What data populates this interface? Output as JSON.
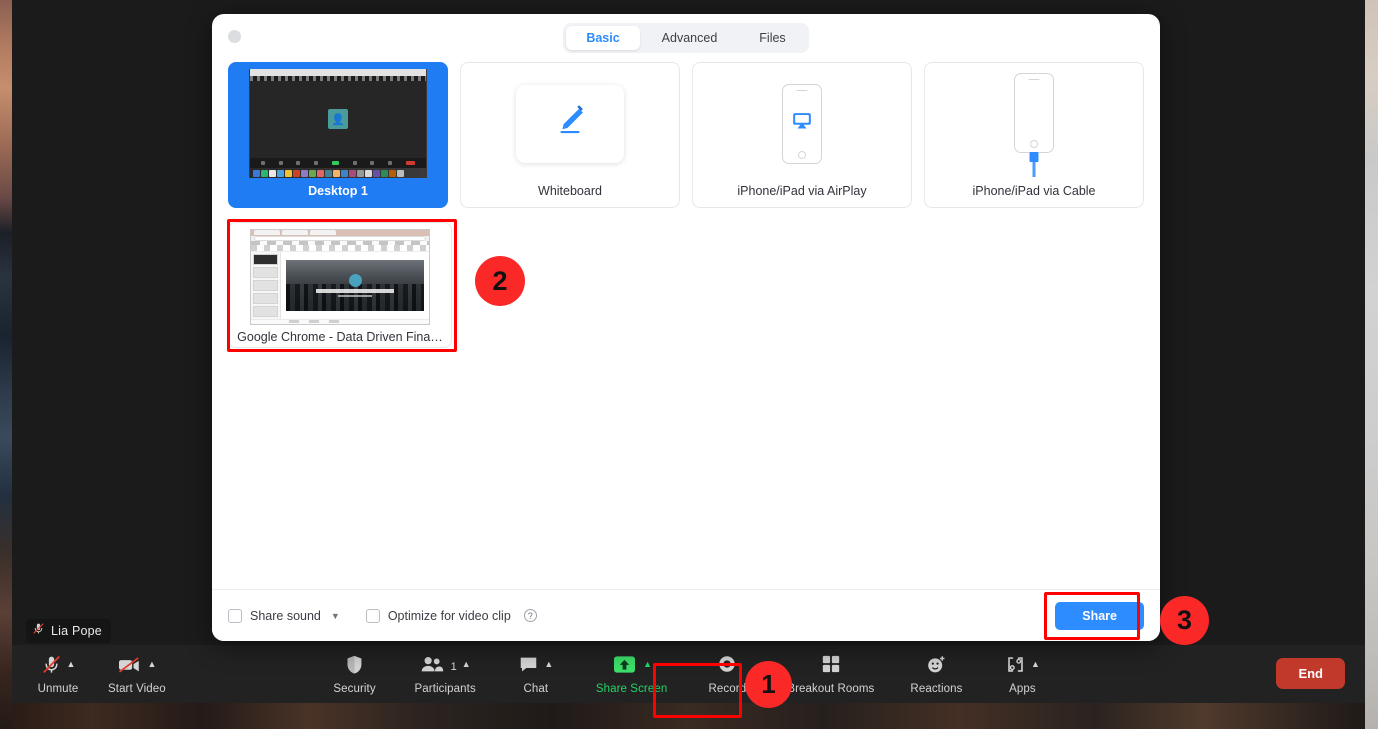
{
  "meeting": {
    "participant_name": "Lia Pope",
    "name_badge_icon": "mic-muted-icon"
  },
  "dialog": {
    "close_button_icon": "close-dot-icon",
    "tabs": [
      {
        "label": "Basic",
        "active": true
      },
      {
        "label": "Advanced",
        "active": false
      },
      {
        "label": "Files",
        "active": false
      }
    ],
    "sources": [
      {
        "label": "Desktop 1",
        "icon": "desktop-thumbnail",
        "selected": true
      },
      {
        "label": "Whiteboard",
        "icon": "pencil-icon",
        "selected": false
      },
      {
        "label": "iPhone/iPad via AirPlay",
        "icon": "airplay-icon",
        "selected": false
      },
      {
        "label": "iPhone/iPad via Cable",
        "icon": "cable-icon",
        "selected": false
      }
    ],
    "windows": [
      {
        "label": "Google Chrome - Data Driven Fina…",
        "icon": "chrome-window-thumbnail",
        "selected": false
      }
    ],
    "footer": {
      "share_sound_label": "Share sound",
      "share_sound_caret_icon": "chevron-down-icon",
      "optimize_label": "Optimize for video clip",
      "optimize_help_icon": "help-circle-icon",
      "help_glyph": "?",
      "share_button_label": "Share"
    }
  },
  "toolbar": {
    "items": [
      {
        "label": "Unmute",
        "icon": "mic-muted-icon",
        "has_caret": true,
        "active": false
      },
      {
        "label": "Start Video",
        "icon": "video-off-icon",
        "has_caret": true,
        "active": false
      },
      {
        "label": "Security",
        "icon": "shield-icon",
        "has_caret": false,
        "active": false
      },
      {
        "label": "Participants",
        "icon": "participants-icon",
        "has_caret": true,
        "count": "1",
        "active": false
      },
      {
        "label": "Chat",
        "icon": "chat-bubble-icon",
        "has_caret": true,
        "active": false
      },
      {
        "label": "Share Screen",
        "icon": "share-screen-up-arrow-icon",
        "has_caret": true,
        "active": true
      },
      {
        "label": "Record",
        "icon": "record-icon",
        "has_caret": false,
        "active": false
      },
      {
        "label": "Breakout Rooms",
        "icon": "grid-squares-icon",
        "has_caret": false,
        "active": false
      },
      {
        "label": "Reactions",
        "icon": "smiley-plus-icon",
        "has_caret": false,
        "active": false
      },
      {
        "label": "Apps",
        "icon": "apps-bracket-icon",
        "has_caret": true,
        "active": false
      }
    ],
    "end_button_label": "End"
  },
  "annotations": {
    "accent_color": "#ff0000",
    "badge_color": "#fb2828",
    "steps": [
      {
        "number": "1",
        "target": "share-screen-toolbar-button"
      },
      {
        "number": "2",
        "target": "chrome-window-source-card"
      },
      {
        "number": "3",
        "target": "share-confirm-button"
      }
    ]
  },
  "colors": {
    "selected_card": "#1f7cf2",
    "primary_button": "#2d8cff",
    "end_button": "#c0392b",
    "active_toolbar": "#25d366",
    "tab_active_text": "#2d8cff"
  }
}
